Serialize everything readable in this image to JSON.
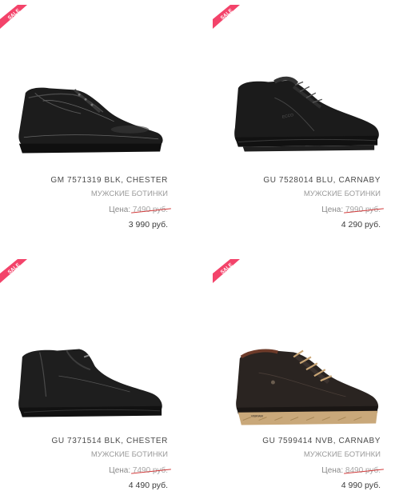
{
  "badge_text": "SALE",
  "price_label": "Цена:",
  "colors": {
    "sale_badge": "#f3436a",
    "strike": "#d23b3b",
    "text": "#4a4a4a",
    "muted": "#9a9a9a"
  },
  "products": [
    {
      "name": "GM 7571319 BLK, CHESTER",
      "category": "МУЖСКИЕ БОТИНКИ",
      "old_price": "7490 руб.",
      "new_price": "3 990 руб."
    },
    {
      "name": "GU 7528014 BLU, CARNABY",
      "category": "МУЖСКИЕ БОТИНКИ",
      "old_price": "7990 руб.",
      "new_price": "4 290 руб."
    },
    {
      "name": "GU 7371514 BLK, CHESTER",
      "category": "МУЖСКИЕ БОТИНКИ",
      "old_price": "7490 руб.",
      "new_price": "4 490 руб."
    },
    {
      "name": "GU 7599414 NVB, CARNABY",
      "category": "МУЖСКИЕ БОТИНКИ",
      "old_price": "8490 руб.",
      "new_price": "4 990 руб."
    }
  ]
}
